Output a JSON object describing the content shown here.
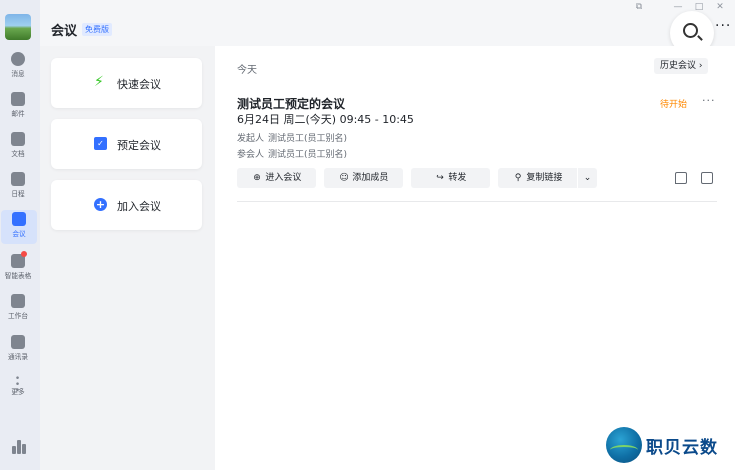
{
  "nav": {
    "items": [
      {
        "label": "消息",
        "icon": "chat-bubble-icon"
      },
      {
        "label": "邮件",
        "icon": "mail-icon"
      },
      {
        "label": "文档",
        "icon": "document-icon"
      },
      {
        "label": "日程",
        "icon": "calendar-icon"
      },
      {
        "label": "会议",
        "icon": "meeting-icon"
      },
      {
        "label": "智能表格",
        "icon": "smart-sheet-icon"
      },
      {
        "label": "工作台",
        "icon": "workbench-icon"
      },
      {
        "label": "通讯录",
        "icon": "contacts-icon"
      },
      {
        "label": "更多",
        "icon": "more-icon"
      }
    ],
    "active": "会议"
  },
  "header": {
    "title": "会议",
    "badge": "免费版"
  },
  "actions": [
    {
      "label": "快速会议",
      "icon": "lightning-icon"
    },
    {
      "label": "预定会议",
      "icon": "calendar-check-icon"
    },
    {
      "label": "加入会议",
      "icon": "plus-circle-icon"
    }
  ],
  "main": {
    "section": "今天",
    "history_button": "历史会议",
    "meeting": {
      "title": "测试员工预定的会议",
      "status": "待开始",
      "time": "6月24日 周二(今天) 09:45 - 10:45",
      "organizer_label": "发起人",
      "organizer": "测试员工(员工别名)",
      "attendees_label": "参会人",
      "attendees": "测试员工(员工别名)",
      "buttons": {
        "enter": "进入会议",
        "add_member": "添加成员",
        "forward": "转发",
        "copy_link": "复制链接"
      }
    }
  },
  "watermark": {
    "text": "职贝云数"
  },
  "colors": {
    "accent": "#3370ff",
    "status_pending": "#ff8800",
    "nav_bg": "#e9ecf3"
  }
}
